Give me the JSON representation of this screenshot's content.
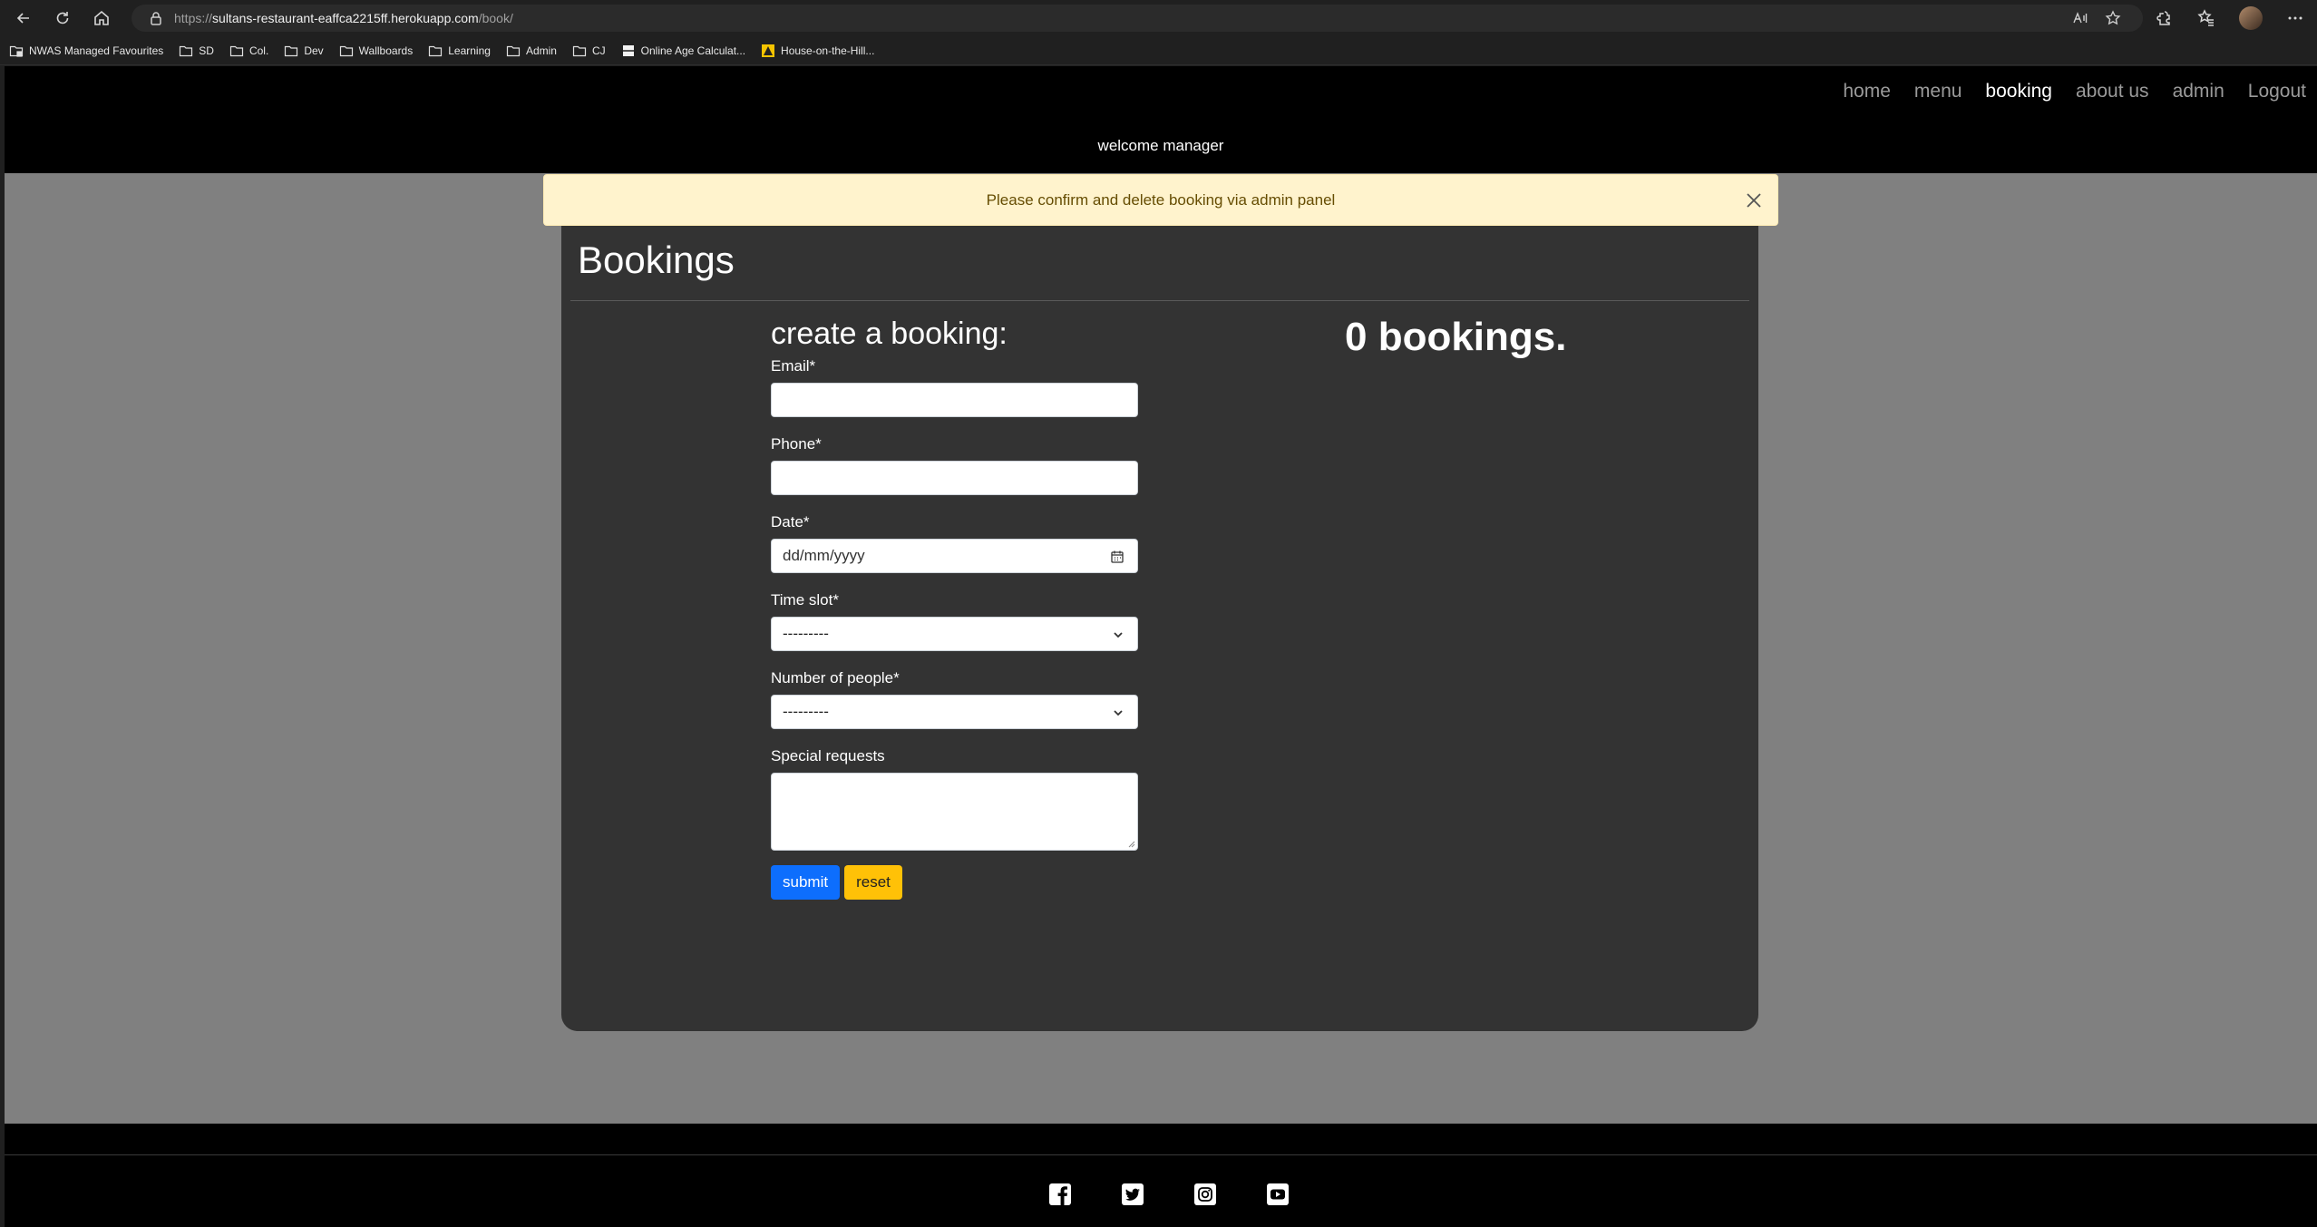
{
  "browser": {
    "url_scheme": "https://",
    "url_host": "sultans-restaurant-eaffca2215ff.herokuapp.com",
    "url_path": "/book/",
    "bookmarks": [
      {
        "label": "NWAS Managed Favourites",
        "icon": "folder-special-icon"
      },
      {
        "label": "SD",
        "icon": "folder-icon"
      },
      {
        "label": "Col.",
        "icon": "folder-icon"
      },
      {
        "label": "Dev",
        "icon": "folder-icon"
      },
      {
        "label": "Wallboards",
        "icon": "folder-icon"
      },
      {
        "label": "Learning",
        "icon": "folder-icon"
      },
      {
        "label": "Admin",
        "icon": "folder-icon"
      },
      {
        "label": "CJ",
        "icon": "folder-icon"
      },
      {
        "label": "Online Age Calculat...",
        "icon": "page-icon"
      },
      {
        "label": "House-on-the-Hill...",
        "icon": "warning-icon"
      }
    ]
  },
  "nav": {
    "items": [
      "home",
      "menu",
      "booking",
      "about us",
      "admin",
      "Logout"
    ],
    "active": "booking"
  },
  "welcome_text": "welcome manager",
  "alert": {
    "message": "Please confirm and delete booking via admin panel"
  },
  "bookings": {
    "title": "Bookings",
    "form_heading": "create a booking:",
    "fields": {
      "email_label": "Email*",
      "phone_label": "Phone*",
      "date_label": "Date*",
      "date_placeholder": "dd/mm/yyyy",
      "time_slot_label": "Time slot*",
      "time_slot_value": "---------",
      "people_label": "Number of people*",
      "people_value": "---------",
      "requests_label": "Special requests"
    },
    "submit_label": "submit",
    "reset_label": "reset",
    "count_text": "0 bookings."
  },
  "footer": {
    "socials": [
      "facebook-icon",
      "twitter-icon",
      "instagram-icon",
      "youtube-icon"
    ]
  },
  "colors": {
    "header_bg": "#000000",
    "page_bg": "#808080",
    "card_bg": "#333333",
    "alert_bg": "#fff3cd",
    "submit_bg": "#0d6efd",
    "reset_bg": "#ffc107"
  }
}
